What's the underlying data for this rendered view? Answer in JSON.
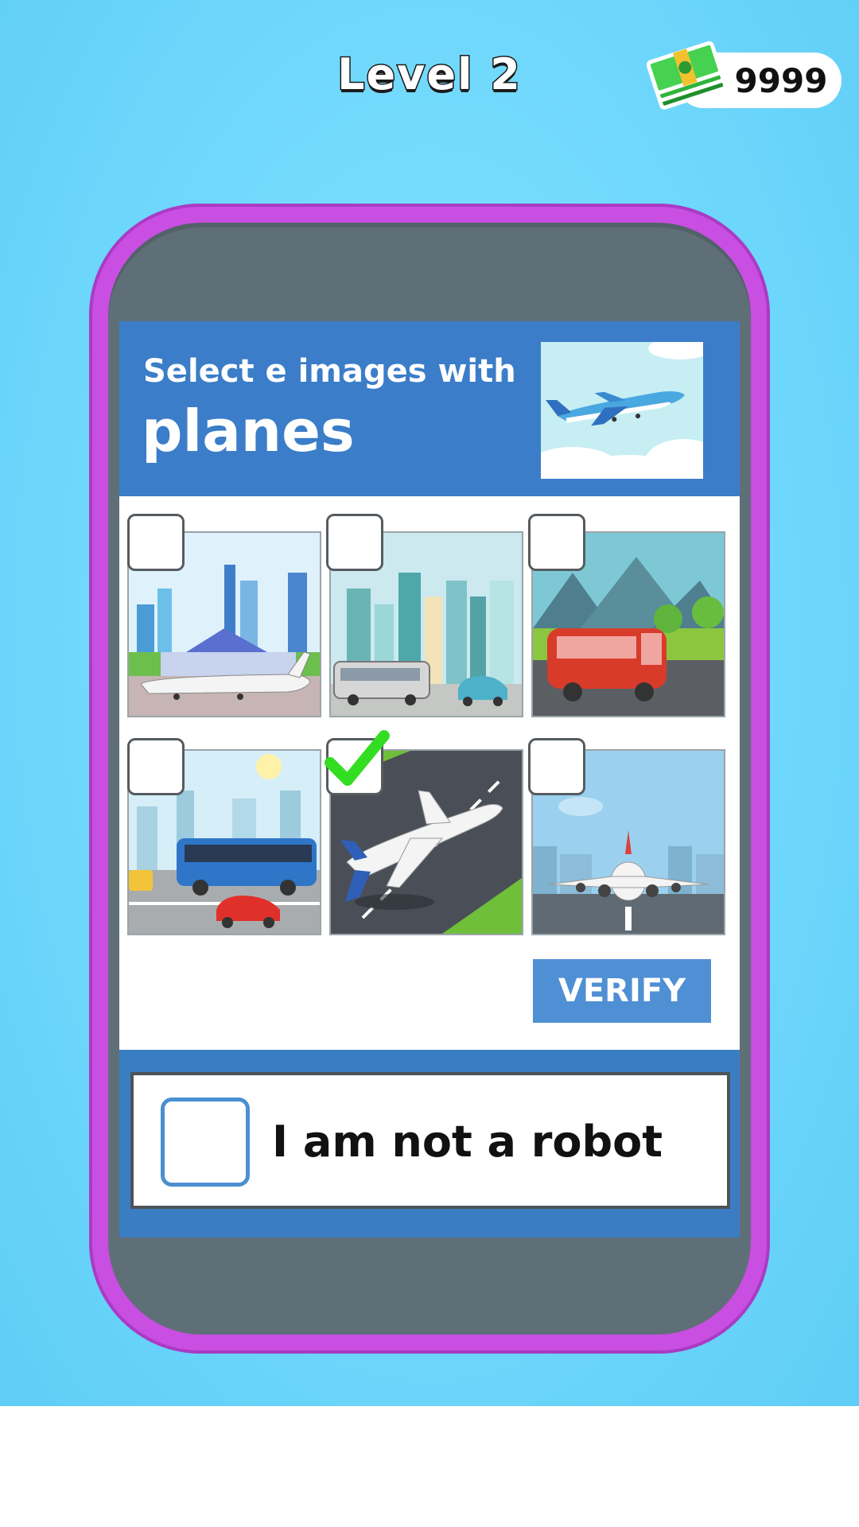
{
  "header": {
    "level_title": "Level 2",
    "coins": "9999",
    "coin_icon": "cash-stack-icon"
  },
  "captcha": {
    "prompt_line1": "Select e images with",
    "prompt_line2": "planes",
    "reference_image": "plane-in-sky",
    "tiles": [
      {
        "scene": "airport-terminal-with-plane",
        "checked": false
      },
      {
        "scene": "city-with-bus-and-car",
        "checked": false
      },
      {
        "scene": "red-bus-mountains",
        "checked": false
      },
      {
        "scene": "city-street-blue-bus",
        "checked": false
      },
      {
        "scene": "plane-on-runway",
        "checked": true
      },
      {
        "scene": "plane-front-view-runway",
        "checked": false
      }
    ],
    "verify_label": "VERIFY"
  },
  "robot": {
    "label": "I am not a robot",
    "checked": false
  },
  "colors": {
    "sky": "#70d8fc",
    "phone_frame": "#c94ee2",
    "phone_body": "#5f6f78",
    "captcha_blue": "#3b7dc8",
    "verify_button": "#4f8fd4",
    "check_green": "#33dd22"
  }
}
